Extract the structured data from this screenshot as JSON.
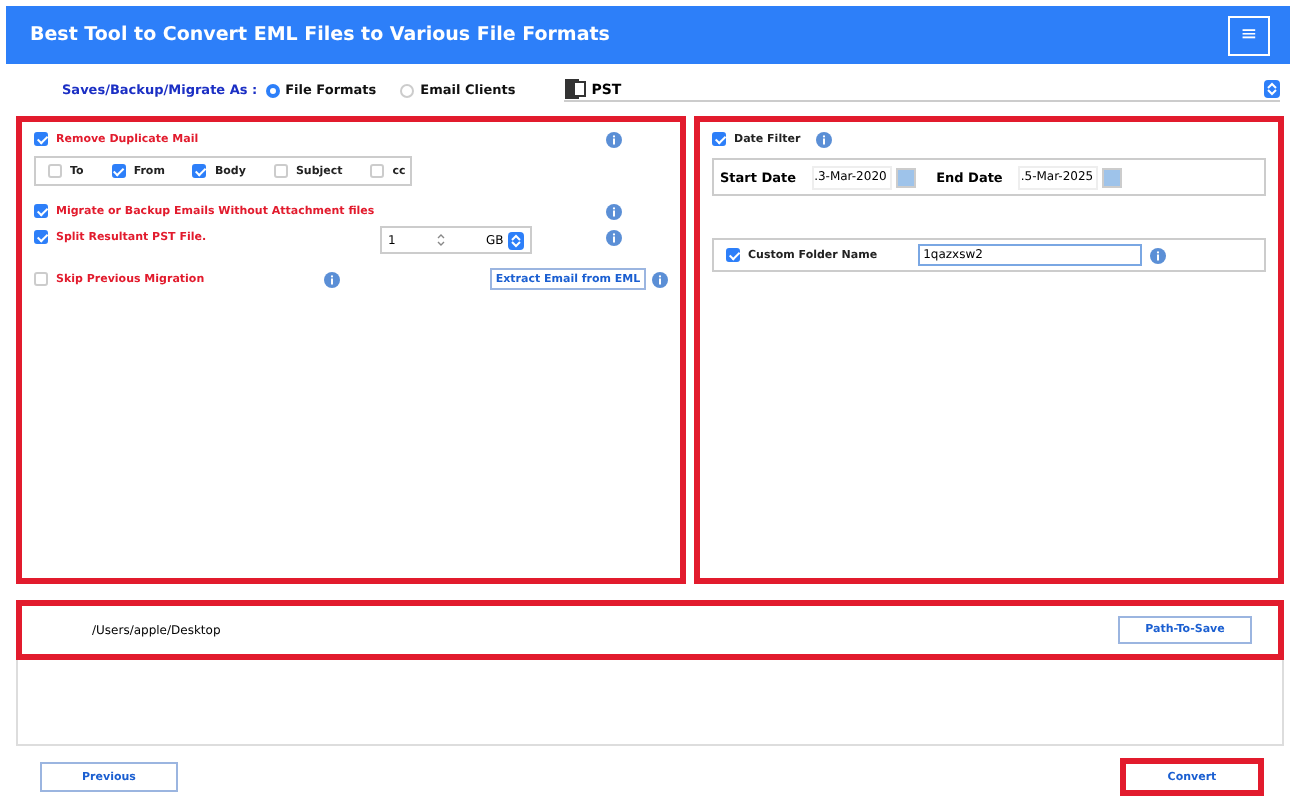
{
  "header": {
    "title": "Best Tool to Convert EML Files to Various File Formats",
    "menu_glyph": "≡"
  },
  "save_as": {
    "label": "Saves/Backup/Migrate As :",
    "options": [
      {
        "label": "File Formats",
        "selected": true
      },
      {
        "label": "Email Clients",
        "selected": false
      }
    ],
    "format": "PST"
  },
  "left_panel": {
    "remove_duplicate": {
      "label": "Remove Duplicate Mail",
      "checked": true
    },
    "duplicate_fields": [
      {
        "label": "To",
        "checked": false
      },
      {
        "label": "From",
        "checked": true
      },
      {
        "label": "Body",
        "checked": true
      },
      {
        "label": "Subject",
        "checked": false
      },
      {
        "label": "cc",
        "checked": false
      }
    ],
    "without_attachment": {
      "label": "Migrate or Backup Emails Without Attachment files",
      "checked": true
    },
    "split": {
      "label": "Split Resultant PST File.",
      "checked": true,
      "size": "1",
      "unit": "GB"
    },
    "skip_previous": {
      "label": "Skip Previous Migration",
      "checked": false
    },
    "extract_button": "Extract Email from EML"
  },
  "right_panel": {
    "date_filter": {
      "label": "Date Filter",
      "checked": true,
      "start_label": "Start Date",
      "start_value": ".3-Mar-2020",
      "end_label": "End Date",
      "end_value": ".5-Mar-2025"
    },
    "custom_folder": {
      "label": "Custom Folder Name",
      "checked": true,
      "value": "1qazxsw2"
    }
  },
  "destination": {
    "path": "/Users/apple/Desktop",
    "button": "Path-To-Save"
  },
  "footer": {
    "previous": "Previous",
    "convert": "Convert"
  }
}
